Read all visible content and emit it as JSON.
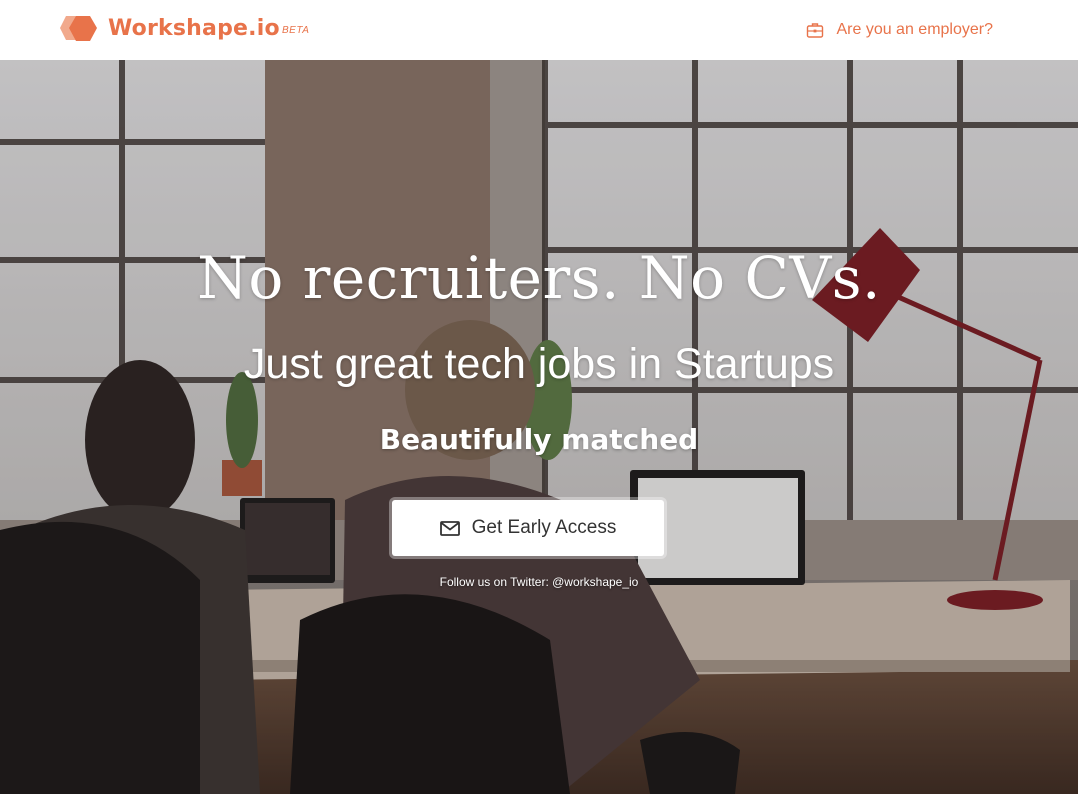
{
  "colors": {
    "brand": "#e8734a",
    "brand_light": "#f1a98c",
    "white": "#ffffff",
    "button_text": "#333333"
  },
  "header": {
    "brand_name": "Workshape.io",
    "beta_label": "BETA",
    "employer_link": "Are you an employer?",
    "employer_icon": "briefcase-icon",
    "logo_icon": "hexagon-logo-icon"
  },
  "hero": {
    "headline": "No recruiters. No CVs.",
    "subheadline": "Just great tech jobs in Startups",
    "tagline": "Beautifully matched",
    "cta_label": "Get Early Access",
    "cta_icon": "envelope-icon",
    "twitter_prefix": "Follow us on Twitter: ",
    "twitter_handle": "@workshape_io"
  }
}
